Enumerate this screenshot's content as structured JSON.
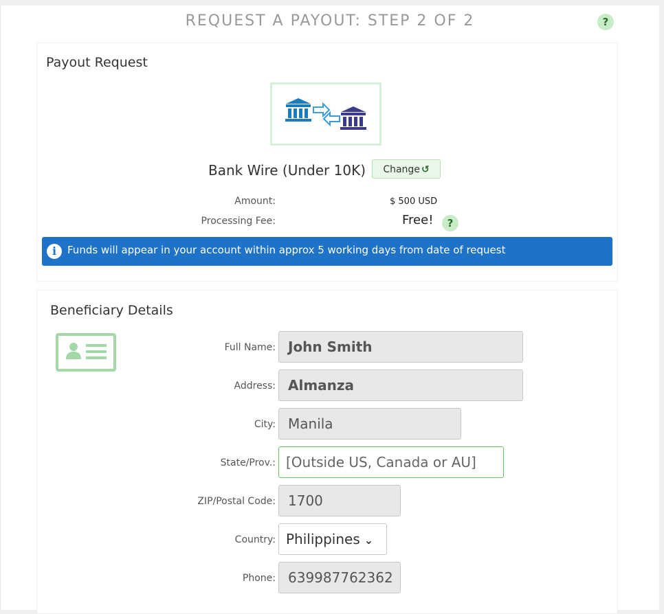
{
  "header": {
    "title": "REQUEST A PAYOUT: STEP 2 OF 2",
    "help": "?"
  },
  "payout": {
    "title": "Payout Request",
    "method_label": "Bank Wire (Under 10K)",
    "change_label": "Change",
    "amount_label": "Amount:",
    "amount_value": "$ 500 USD",
    "fee_label": "Processing Fee:",
    "fee_value": "Free!",
    "fee_help": "?",
    "info_text": "Funds will appear in your account within approx 5 working days from date of request"
  },
  "beneficiary": {
    "title": "Beneficiary Details",
    "fields": [
      {
        "label": "Full Name:",
        "value": "John Smith"
      },
      {
        "label": "Address:",
        "value": "Almanza"
      },
      {
        "label": "City:",
        "value": "Manila"
      },
      {
        "label": "State/Prov.:",
        "value": "[Outside US, Canada or AU]"
      },
      {
        "label": "ZIP/Postal Code:",
        "value": "1700"
      },
      {
        "label": "Country:",
        "value": "Philippines"
      },
      {
        "label": "Phone:",
        "value": "639987762362"
      }
    ]
  },
  "colors": {
    "info_bar": "#1e73c8",
    "help_badge": "#c8ecc8",
    "change_button": "#eaf8ea",
    "accent_green": "#a3d8a8"
  },
  "icons": [
    "help-icon",
    "bank-transfer-icon",
    "refresh-icon",
    "info-icon",
    "id-card-icon",
    "chevron-down-icon"
  ]
}
